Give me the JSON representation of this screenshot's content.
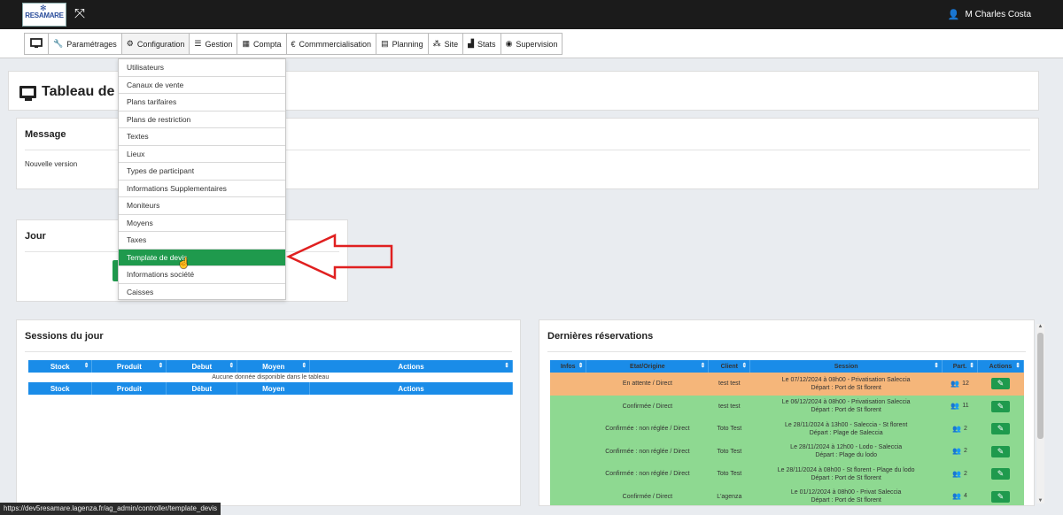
{
  "topbar": {
    "logo_text": "RESAMARE",
    "user_name": "M Charles Costa"
  },
  "menu": [
    {
      "label": "",
      "icon": "monitor-icon"
    },
    {
      "label": "Paramétrages",
      "icon": "wrench-icon"
    },
    {
      "label": "Configuration",
      "icon": "gears-icon"
    },
    {
      "label": "Gestion",
      "icon": "list-icon"
    },
    {
      "label": "Compta",
      "icon": "calculator-icon"
    },
    {
      "label": "Commmercialisation",
      "icon": "euro-icon"
    },
    {
      "label": "Planning",
      "icon": "calendar-icon"
    },
    {
      "label": "Site",
      "icon": "sitemap-icon"
    },
    {
      "label": "Stats",
      "icon": "chart-icon"
    },
    {
      "label": "Supervision",
      "icon": "eye-icon"
    }
  ],
  "dropdown": {
    "items": [
      "Utilisateurs",
      "Canaux de vente",
      "Plans tarifaires",
      "Plans de restriction",
      "Textes",
      "Lieux",
      "Types de participant",
      "Informations Supplementaires",
      "Moniteurs",
      "Moyens",
      "Taxes",
      "Template de devis",
      "Informations société",
      "Caisses"
    ],
    "highlighted_index": 11
  },
  "page": {
    "title": "Tableau de bo"
  },
  "message_panel": {
    "title": "Message",
    "text": "Nouvelle version"
  },
  "jour_panel": {
    "title": "Jour"
  },
  "sessions_panel": {
    "title": "Sessions du jour",
    "columns": [
      "Stock",
      "Produit",
      "Debut",
      "Moyen",
      "Actions"
    ],
    "footer_columns": [
      "Stock",
      "Produit",
      "Début",
      "Moyen",
      "Actions"
    ],
    "empty_text": "Aucune donnée disponible dans le tableau"
  },
  "reservations_panel": {
    "title": "Dernières réservations",
    "columns": [
      "Infos",
      "Etat/Origine",
      "Client",
      "Session",
      "Part.",
      "Actions"
    ],
    "rows": [
      {
        "status": "En attente / Direct",
        "client": "test test",
        "session_line1": "Le 07/12/2024 à 08h00 - Privatisation Saleccia",
        "session_line2": "Départ : Port de St florent",
        "part": "12",
        "color": "orange"
      },
      {
        "status": "Confirmée / Direct",
        "client": "test test",
        "session_line1": "Le 06/12/2024 à 08h00 - Privatisation Saleccia",
        "session_line2": "Départ : Port de St florent",
        "part": "11",
        "color": "green"
      },
      {
        "status": "Confirmée : non réglée / Direct",
        "client": "Toto Test",
        "session_line1": "Le 28/11/2024 à 13h00 - Saleccia - St florent",
        "session_line2": "Départ : Plage de Saleccia",
        "part": "2",
        "color": "green"
      },
      {
        "status": "Confirmée : non réglée / Direct",
        "client": "Toto Test",
        "session_line1": "Le 28/11/2024 à 12h00 - Lodo - Saleccia",
        "session_line2": "Départ : Plage du lodo",
        "part": "2",
        "color": "green"
      },
      {
        "status": "Confirmée : non réglée / Direct",
        "client": "Toto Test",
        "session_line1": "Le 28/11/2024 à 08h00 - St florent - Plage du lodo",
        "session_line2": "Départ : Port de St florent",
        "part": "2",
        "color": "green"
      },
      {
        "status": "Confirmée / Direct",
        "client": "L'agenza",
        "session_line1": "Le 01/12/2024 à 08h00 - Privat Saleccia",
        "session_line2": "Départ : Port de St florent",
        "part": "4",
        "color": "green"
      }
    ]
  },
  "statusbar": {
    "url": "https://dev5resamare.lagenza.fr/ag_admin/controller/template_devis"
  },
  "colors": {
    "topbar": "#1b1b1b",
    "table_header": "#1a8ce8",
    "highlight_green": "#1f9a4d",
    "row_orange": "#f5b67a",
    "row_green": "#8ed991",
    "arrow_red": "#e02020"
  }
}
